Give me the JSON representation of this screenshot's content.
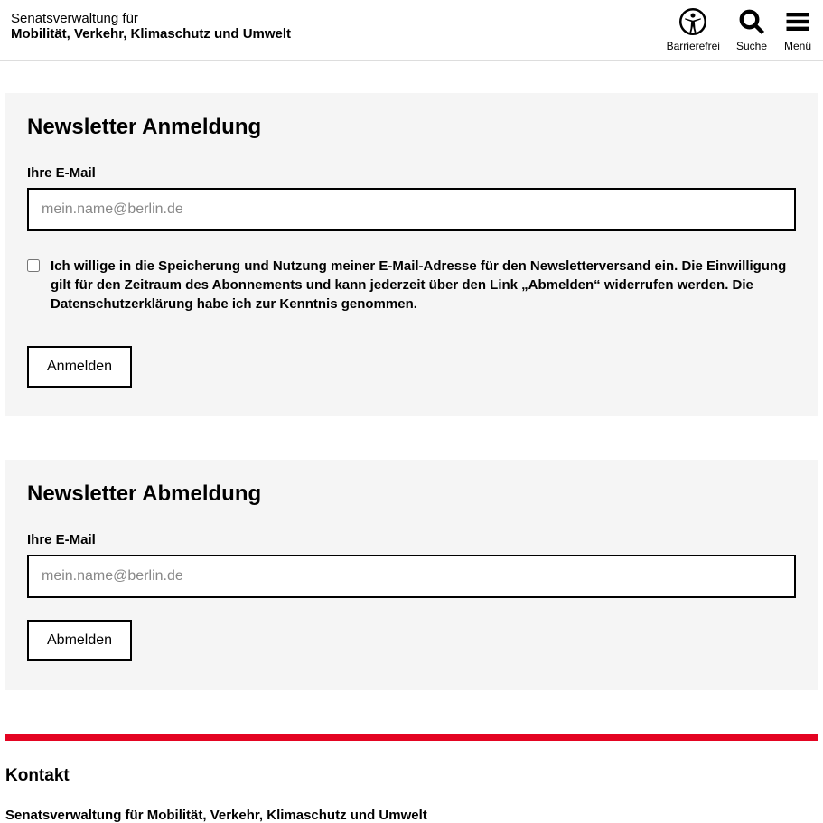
{
  "header": {
    "line1": "Senatsverwaltung für",
    "line2": "Mobilität, Verkehr, Klimaschutz und Umwelt",
    "tools": {
      "accessibility": "Barrierefrei",
      "search": "Suche",
      "menu": "Menü"
    }
  },
  "subscribe": {
    "title": "Newsletter Anmeldung",
    "email_label": "Ihre E-Mail",
    "email_placeholder": "mein.name@berlin.de",
    "consent_text": "Ich willige in die Speicherung und Nutzung meiner E-Mail-Adresse für den Newsletterversand ein. Die Einwilligung gilt für den Zeitraum des Abonnements und kann jederzeit über den Link „Abmelden“ widerrufen werden. Die Datenschutzerklärung habe ich zur Kenntnis genommen.",
    "submit_label": "Anmelden"
  },
  "unsubscribe": {
    "title": "Newsletter Abmeldung",
    "email_label": "Ihre E-Mail",
    "email_placeholder": "mein.name@berlin.de",
    "submit_label": "Abmelden"
  },
  "footer": {
    "contact_title": "Kontakt",
    "org_name": "Senatsverwaltung für Mobilität, Verkehr, Klimaschutz und Umwelt"
  }
}
